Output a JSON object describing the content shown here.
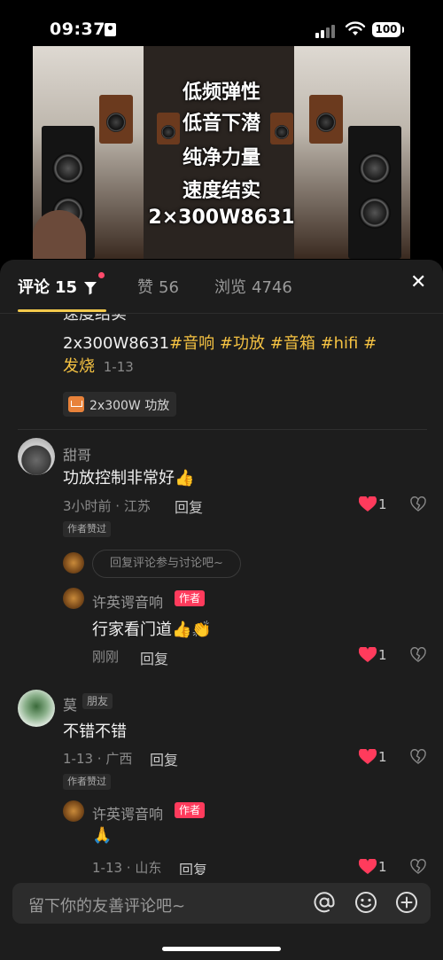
{
  "status_bar": {
    "time": "09:37",
    "battery": "100"
  },
  "video": {
    "overlay_lines": [
      "低频弹性",
      "低音下潜",
      "纯净力量",
      "速度结实",
      "2×300W8631"
    ]
  },
  "tabs": {
    "comments": {
      "label": "评论",
      "count": "15"
    },
    "likes": {
      "label": "赞",
      "count": "56"
    },
    "views": {
      "label": "浏览",
      "count": "4746"
    }
  },
  "post": {
    "clipped_line": "速度结实",
    "line1_text": "2x300W8631",
    "line1_tags": [
      "#音响",
      "#功放",
      "#音箱",
      "#hifi",
      "#"
    ],
    "line2_tag": "发烧",
    "date": "1-13",
    "product_label": "2x300W 功放"
  },
  "comments": [
    {
      "name": "甜哥",
      "text": "功放控制非常好",
      "emoji": "👍",
      "meta": "3小时前 · 江苏",
      "reply_label": "回复",
      "likes": "1",
      "badge": "作者赞过",
      "reply_prompt": "回复评论参与讨论吧~",
      "author_reply": {
        "name": "许英谔音响",
        "badge": "作者",
        "text": "行家看门道",
        "emoji": "👍👏",
        "meta": "刚刚",
        "reply_label": "回复",
        "likes": "1"
      }
    },
    {
      "name": "莫",
      "friend_badge": "朋友",
      "text": "不错不错",
      "meta": "1-13 · 广西",
      "reply_label": "回复",
      "likes": "1",
      "badge": "作者赞过",
      "author_reply": {
        "name": "许英谔音响",
        "badge": "作者",
        "emoji": "🙏",
        "meta": "1-13 · 山东",
        "reply_label": "回复",
        "likes": "1"
      }
    }
  ],
  "input": {
    "placeholder": "留下你的友善评论吧~"
  },
  "colors": {
    "accent_tag": "#f5c242",
    "heart": "#ff3b5c",
    "sheet_bg": "#1d1d1d"
  }
}
